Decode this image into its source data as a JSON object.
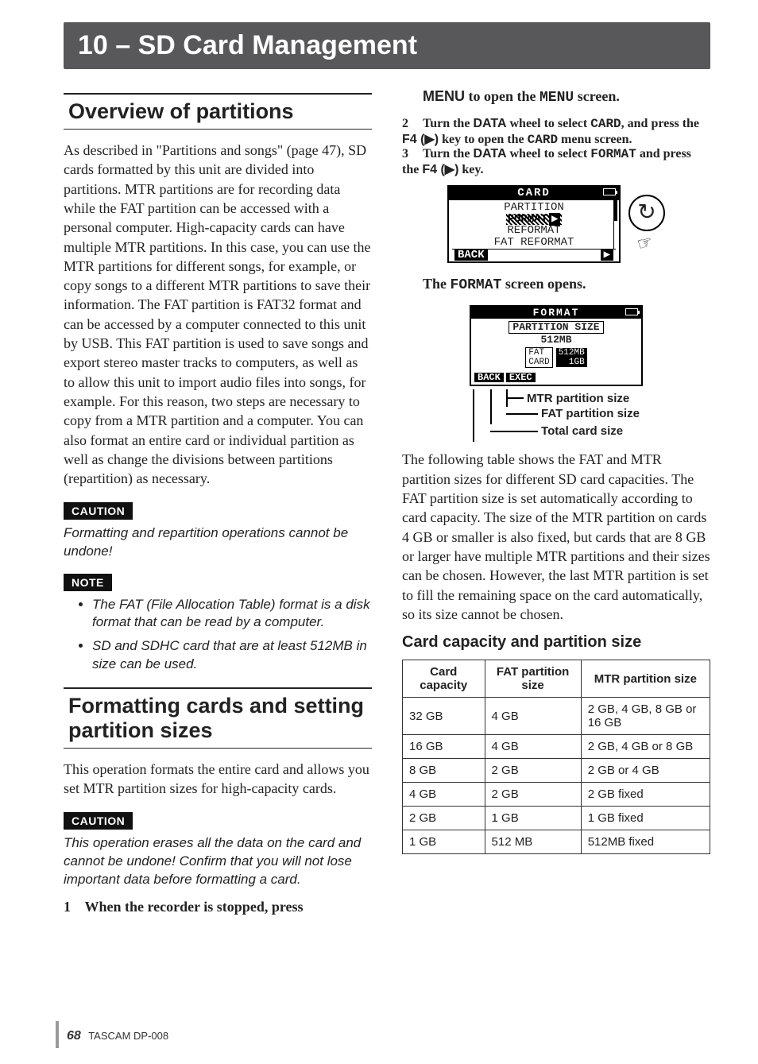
{
  "chapter": "10 – SD Card Management",
  "left": {
    "section1_title": "Overview of partitions",
    "section1_body": "As described in \"Partitions and songs\" (page 47), SD cards formatted by this unit are divided into partitions. MTR partitions are for recording data while the FAT partition can be accessed with a personal computer. High-capacity cards can have multiple MTR partitions. In this case, you can use the MTR partitions for different songs, for example, or copy songs to a different MTR partitions to save their information. The FAT partition is FAT32 format and can be accessed by a computer connected to this unit by USB. This FAT partition is used to save songs and export stereo master tracks to computers, as well as to allow this unit to import audio files into songs, for example. For this reason, two steps are necessary to copy from a MTR partition and a computer. You can also format an entire card or individual partition as well as change the divisions between partitions (repartition) as necessary.",
    "caution1_label": "CAUTION",
    "caution1_text": "Formatting and repartition operations cannot be undone!",
    "note_label": "NOTE",
    "note_items": [
      "The FAT (File Allocation Table) format is a disk format that can be read by a computer.",
      "SD and SDHC card that are at least 512MB in size can be used."
    ],
    "section2_title": "Formatting cards and setting partition sizes",
    "section2_body": "This operation formats the entire card and allows you set MTR partition sizes for high-capacity cards.",
    "caution2_label": "CAUTION",
    "caution2_text": "This operation erases all the data on the card and cannot be undone! Confirm that you will not lose important data before formatting a card.",
    "step1_num": "1",
    "step1_text_a": "When the recorder is stopped, press"
  },
  "right": {
    "step1_text_b_pre": "MENU",
    "step1_text_b_mid": " to open the ",
    "step1_text_b_mono": "MENU",
    "step1_text_b_post": " screen.",
    "step2_num": "2",
    "step2_a": "Turn the ",
    "step2_b": "DATA",
    "step2_c": " wheel to select ",
    "step2_d": "CARD",
    "step2_e": ", and press the ",
    "step2_f": "F4 (▶)",
    "step2_g": " key to open the ",
    "step2_h": "CARD",
    "step2_i": " menu screen.",
    "step3_num": "3",
    "step3_a": "Turn the ",
    "step3_b": "DATA",
    "step3_c": " wheel to select ",
    "step3_d": "FORMAT",
    "step3_e": " and press the ",
    "step3_f": "F4 (▶)",
    "step3_g": " key.",
    "lcd1": {
      "title": "CARD",
      "items": [
        "PARTITION",
        "FORMAT",
        "REFORMAT",
        "FAT REFORMAT"
      ],
      "foot_left": "BACK",
      "foot_right": "▶"
    },
    "after_lcd1_a": "The ",
    "after_lcd1_b": "FORMAT",
    "after_lcd1_c": " screen opens.",
    "lcd2": {
      "title": "FORMAT",
      "partition_label": "PARTITION SIZE",
      "partition_value": "512MB",
      "fat_label": "FAT\nCARD",
      "fat_values": "512MB\n1GB",
      "foot": [
        "BACK",
        "EXEC"
      ]
    },
    "annotations": {
      "mtr": "MTR partition size",
      "fat": "FAT partition size",
      "total": "Total card size"
    },
    "para": "The following table shows the FAT and MTR partition sizes for different SD card capacities. The FAT partition size is set automatically according to card capacity. The size of the MTR partition on cards 4 GB or smaller is also fixed, but cards that are 8 GB or larger have multiple MTR partitions and their sizes can be chosen. However, the last MTR partition is set to fill the remaining space on the card automatically, so its size cannot be chosen.",
    "subhead": "Card capacity and partition size",
    "table": {
      "headers": [
        "Card capacity",
        "FAT partition size",
        "MTR partition size"
      ],
      "rows": [
        [
          "32 GB",
          "4 GB",
          "2 GB, 4 GB, 8 GB or 16 GB"
        ],
        [
          "16 GB",
          "4 GB",
          "2 GB, 4 GB or 8 GB"
        ],
        [
          "8 GB",
          "2 GB",
          "2 GB or 4 GB"
        ],
        [
          "4 GB",
          "2 GB",
          "2 GB fixed"
        ],
        [
          "2 GB",
          "1 GB",
          "1 GB fixed"
        ],
        [
          "1 GB",
          "512 MB",
          "512MB fixed"
        ]
      ]
    }
  },
  "footer": {
    "page": "68",
    "model": "TASCAM  DP-008"
  }
}
